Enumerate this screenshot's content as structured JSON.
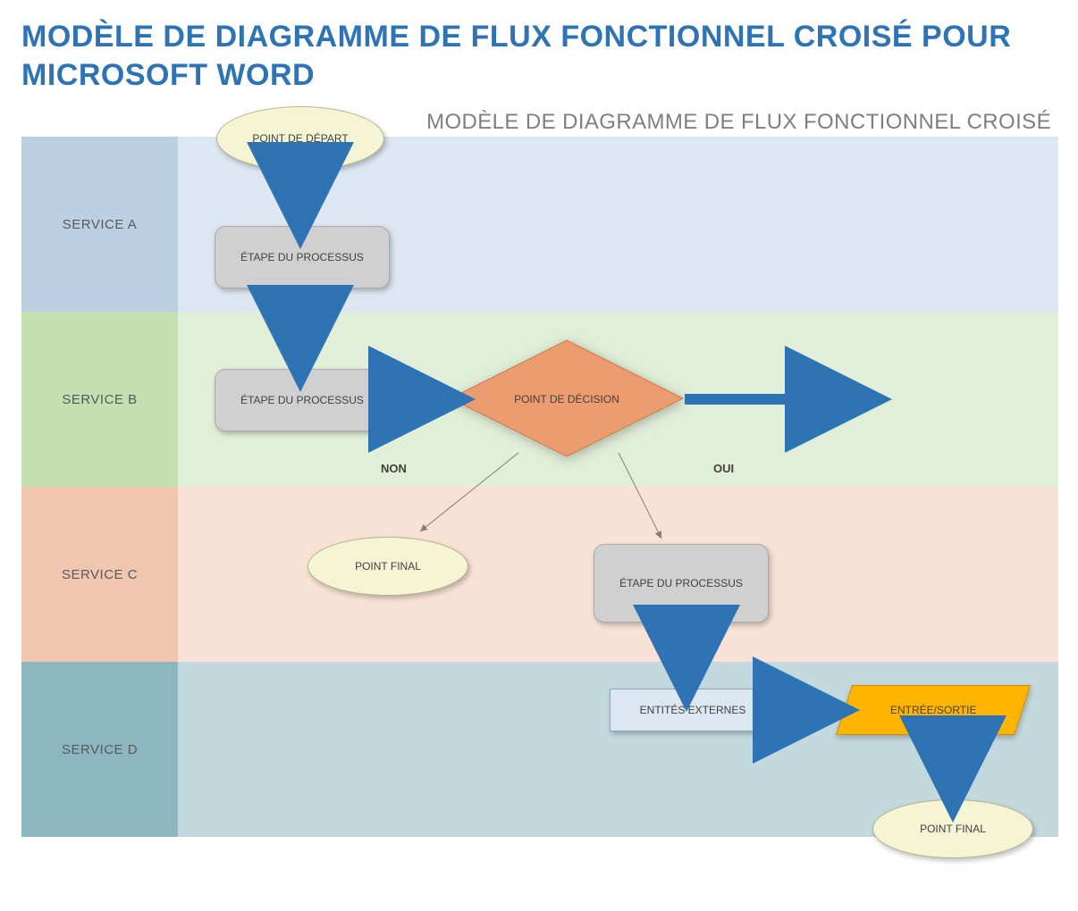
{
  "title": "MODÈLE DE DIAGRAMME DE FLUX FONCTIONNEL CROISÉ POUR MICROSOFT WORD",
  "subtitle": "MODÈLE DE DIAGRAMME DE FLUX FONCTIONNEL CROISÉ",
  "lanes": {
    "a": "SERVICE A",
    "b": "SERVICE B",
    "c": "SERVICE C",
    "d": "SERVICE D"
  },
  "shapes": {
    "start": "POINT DE DÉPART",
    "process1": "ÉTAPE DU PROCESSUS",
    "process2": "ÉTAPE DU PROCESSUS",
    "decision": "POINT DE DÉCISION",
    "process3": "ÉTAPE DU PROCESSUS",
    "end1": "POINT FINAL",
    "external": "ENTITÉS EXTERNES",
    "io": "ENTRÉE/SORTIE",
    "end2": "POINT FINAL"
  },
  "branches": {
    "no": "NON",
    "yes": "OUI"
  },
  "colors": {
    "title": "#2e74b5",
    "arrow": "#2e74b5",
    "decisionFill": "#ed9c6f",
    "ioFill": "#ffb400"
  }
}
